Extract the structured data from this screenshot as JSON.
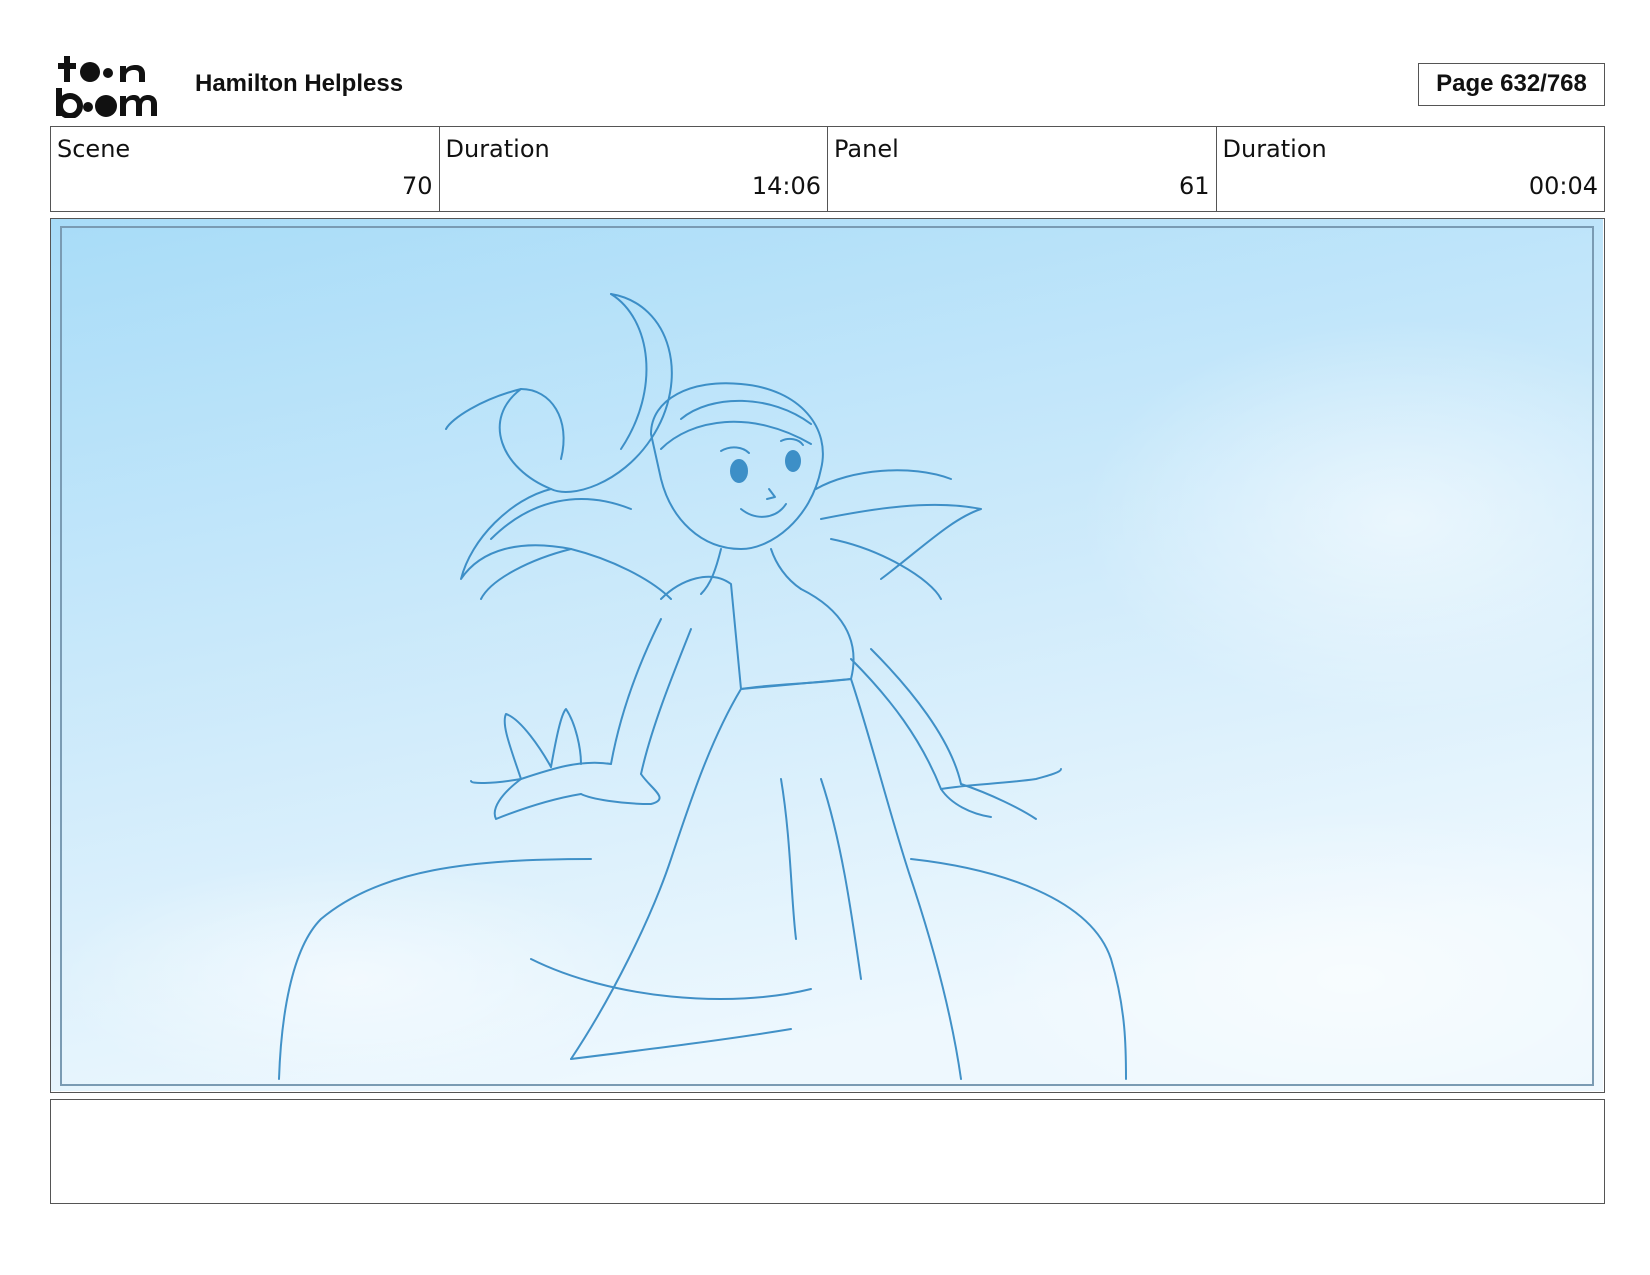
{
  "header": {
    "logo_text": "toon boom",
    "project_title": "Hamilton Helpless",
    "page_indicator": "Page 632/768"
  },
  "info": [
    {
      "label": "Scene",
      "value": "70"
    },
    {
      "label": "Duration",
      "value": "14:06"
    },
    {
      "label": "Panel",
      "value": "61"
    },
    {
      "label": "Duration",
      "value": "00:04"
    }
  ],
  "panel": {
    "image_subject": "sketch-of-girl-in-gown-against-sky",
    "sky_color_top": "#a8dcf8",
    "sky_color_bottom": "#eaf6fd",
    "line_color": "#2f86c2"
  },
  "notes": {
    "text": ""
  }
}
